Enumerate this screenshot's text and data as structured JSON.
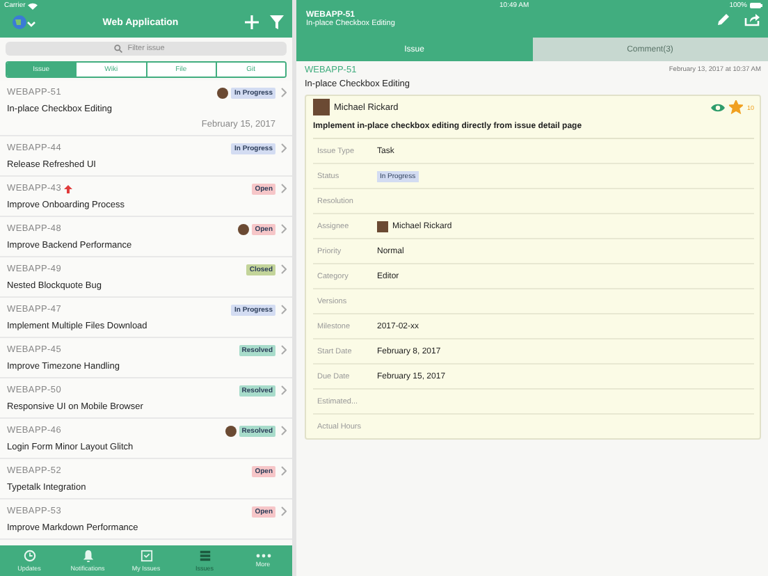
{
  "status_bar": {
    "carrier": "Carrier",
    "time": "10:49 AM",
    "battery": "100%"
  },
  "list_header": {
    "title": "Web Application"
  },
  "search": {
    "placeholder": "Filter issue"
  },
  "segments": [
    {
      "label": "Issue",
      "selected": true
    },
    {
      "label": "Wiki",
      "selected": false
    },
    {
      "label": "File",
      "selected": false
    },
    {
      "label": "Git",
      "selected": false
    }
  ],
  "issues": [
    {
      "key": "WEBAPP-51",
      "title": "In-place Checkbox Editing",
      "status": "In Progress",
      "color": "#d3dcf2",
      "avatar": true,
      "high_priority": false,
      "date": "February 15, 2017"
    },
    {
      "key": "WEBAPP-44",
      "title": "Release Refreshed UI",
      "status": "In Progress",
      "color": "#d3dcf2",
      "avatar": false,
      "high_priority": false
    },
    {
      "key": "WEBAPP-43",
      "title": "Improve Onboarding Process",
      "status": "Open",
      "color": "#f6c6c8",
      "avatar": false,
      "high_priority": true
    },
    {
      "key": "WEBAPP-48",
      "title": "Improve Backend Performance",
      "status": "Open",
      "color": "#f6c6c8",
      "avatar": true,
      "high_priority": false
    },
    {
      "key": "WEBAPP-49",
      "title": "Nested Blockquote Bug",
      "status": "Closed",
      "color": "#c3d49a",
      "avatar": false,
      "high_priority": false
    },
    {
      "key": "WEBAPP-47",
      "title": "Implement Multiple Files Download",
      "status": "In Progress",
      "color": "#d3dcf2",
      "avatar": false,
      "high_priority": false
    },
    {
      "key": "WEBAPP-45",
      "title": "Improve Timezone Handling",
      "status": "Resolved",
      "color": "#a8dccb",
      "avatar": false,
      "high_priority": false
    },
    {
      "key": "WEBAPP-50",
      "title": "Responsive UI on Mobile Browser",
      "status": "Resolved",
      "color": "#a8dccb",
      "avatar": false,
      "high_priority": false
    },
    {
      "key": "WEBAPP-46",
      "title": "Login Form Minor Layout Glitch",
      "status": "Resolved",
      "color": "#a8dccb",
      "avatar": true,
      "high_priority": false
    },
    {
      "key": "WEBAPP-52",
      "title": "Typetalk Integration",
      "status": "Open",
      "color": "#f6c6c8",
      "avatar": false,
      "high_priority": false
    },
    {
      "key": "WEBAPP-53",
      "title": "Improve Markdown Performance",
      "status": "Open",
      "color": "#f6c6c8",
      "avatar": false,
      "high_priority": false
    }
  ],
  "tab_bar": [
    {
      "label": "Updates",
      "selected": false
    },
    {
      "label": "Notifications",
      "selected": false
    },
    {
      "label": "My Issues",
      "selected": false
    },
    {
      "label": "Issues",
      "selected": true
    },
    {
      "label": "More",
      "selected": false
    }
  ],
  "detail_header": {
    "key": "WEBAPP-51",
    "title": "In-place Checkbox Editing"
  },
  "detail_tabs": [
    {
      "label": "Issue",
      "selected": true
    },
    {
      "label": "Comment(3)",
      "selected": false
    }
  ],
  "detail": {
    "key": "WEBAPP-51",
    "created": "February 13, 2017 at 10:37 AM",
    "title": "In-place Checkbox Editing",
    "author": "Michael Rickard",
    "watching": true,
    "starred": true,
    "star_count": "10",
    "description": "Implement in-place checkbox editing directly from issue detail page",
    "fields": [
      {
        "label": "Issue Type",
        "kind": "text",
        "value": "Task"
      },
      {
        "label": "Status",
        "kind": "status",
        "value": "In Progress"
      },
      {
        "label": "Resolution",
        "kind": "text"
      },
      {
        "label": "Assignee",
        "kind": "user",
        "value": "Michael Rickard"
      },
      {
        "label": "Priority",
        "kind": "text",
        "value": "Normal"
      },
      {
        "label": "Category",
        "kind": "text",
        "value": "Editor"
      },
      {
        "label": "Versions",
        "kind": "text"
      },
      {
        "label": "Milestone",
        "kind": "text",
        "value": "2017-02-xx"
      },
      {
        "label": "Start Date",
        "kind": "text",
        "value": "February 8, 2017"
      },
      {
        "label": "Due Date",
        "kind": "text",
        "value": "February 15, 2017"
      },
      {
        "label": "Estimated...",
        "kind": "text"
      },
      {
        "label": "Actual Hours",
        "kind": "text"
      }
    ]
  }
}
